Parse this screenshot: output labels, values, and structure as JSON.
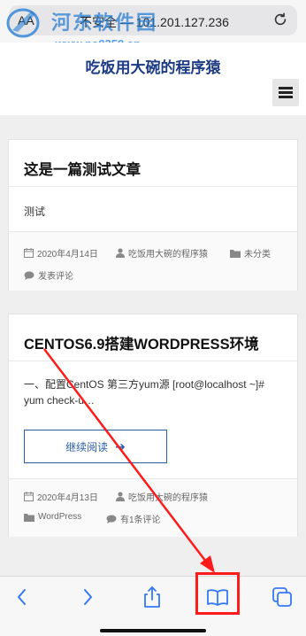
{
  "browser": {
    "text_size_label": "AA",
    "address_text": "不安全 — 101.201.127.236"
  },
  "watermark": {
    "title": "河东软件园",
    "url": "www.pc0359.cn"
  },
  "site": {
    "title": "吃饭用大碗的程序猿"
  },
  "posts": [
    {
      "title": "这是一篇测试文章",
      "excerpt": "测试",
      "date": "2020年4月14日",
      "author": "吃饭用大碗的程序猿",
      "category": "未分类",
      "comments": "发表评论"
    },
    {
      "title": "CENTOS6.9搭建WORDPRESS环境",
      "excerpt": "一、配置CentOS 第三方yum源 [root@localhost ~]# yum check-u…",
      "read_more": "继续阅读",
      "date": "2020年4月13日",
      "author": "吃饭用大碗的程序猿",
      "category": "WordPress",
      "comments": "有1条评论"
    }
  ],
  "icons": {
    "back": "chevron-left-icon",
    "forward": "chevron-right-icon",
    "share": "share-icon",
    "bookmarks": "book-icon",
    "tabs": "tabs-icon"
  },
  "colors": {
    "accent": "#2a5ea8",
    "site_title": "#1c3b84",
    "annotation": "#ff1b1b",
    "toolbar_icon": "#3478f6"
  }
}
